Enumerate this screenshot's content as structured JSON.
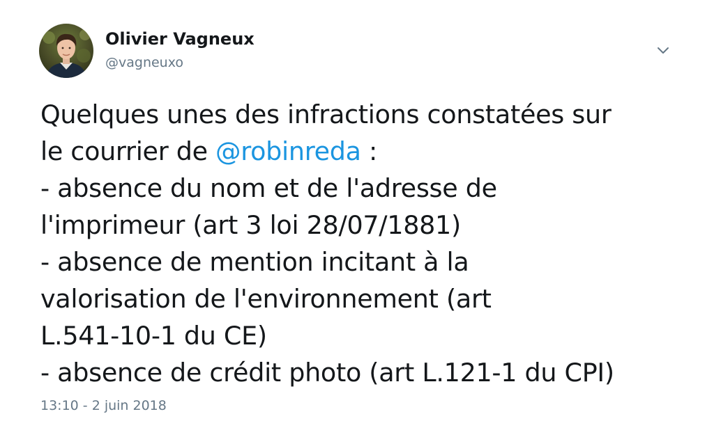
{
  "author": {
    "display_name": "Olivier Vagneux",
    "handle": "@vagneuxo",
    "avatar_icon": "profile-photo-icon"
  },
  "menu": {
    "caret_icon": "chevron-down-icon"
  },
  "tweet": {
    "line1": "Quelques unes des infractions constatées sur",
    "line2_prefix": "le courrier de ",
    "mention": "@robinreda",
    "line2_suffix": " :",
    "line3": "- absence du nom et de l'adresse de",
    "line4": "l'imprimeur (art 3 loi 28/07/1881)",
    "line5": "- absence de mention incitant à la",
    "line6": "valorisation de l'environnement (art",
    "line7": "L.541-10-1 du CE)",
    "line8": "- absence de crédit photo (art L.121-1 du CPI)"
  },
  "timestamp": "13:10 - 2 juin 2018",
  "colors": {
    "text": "#14171a",
    "secondary": "#657786",
    "link": "#1b95e0",
    "background": "#ffffff"
  }
}
